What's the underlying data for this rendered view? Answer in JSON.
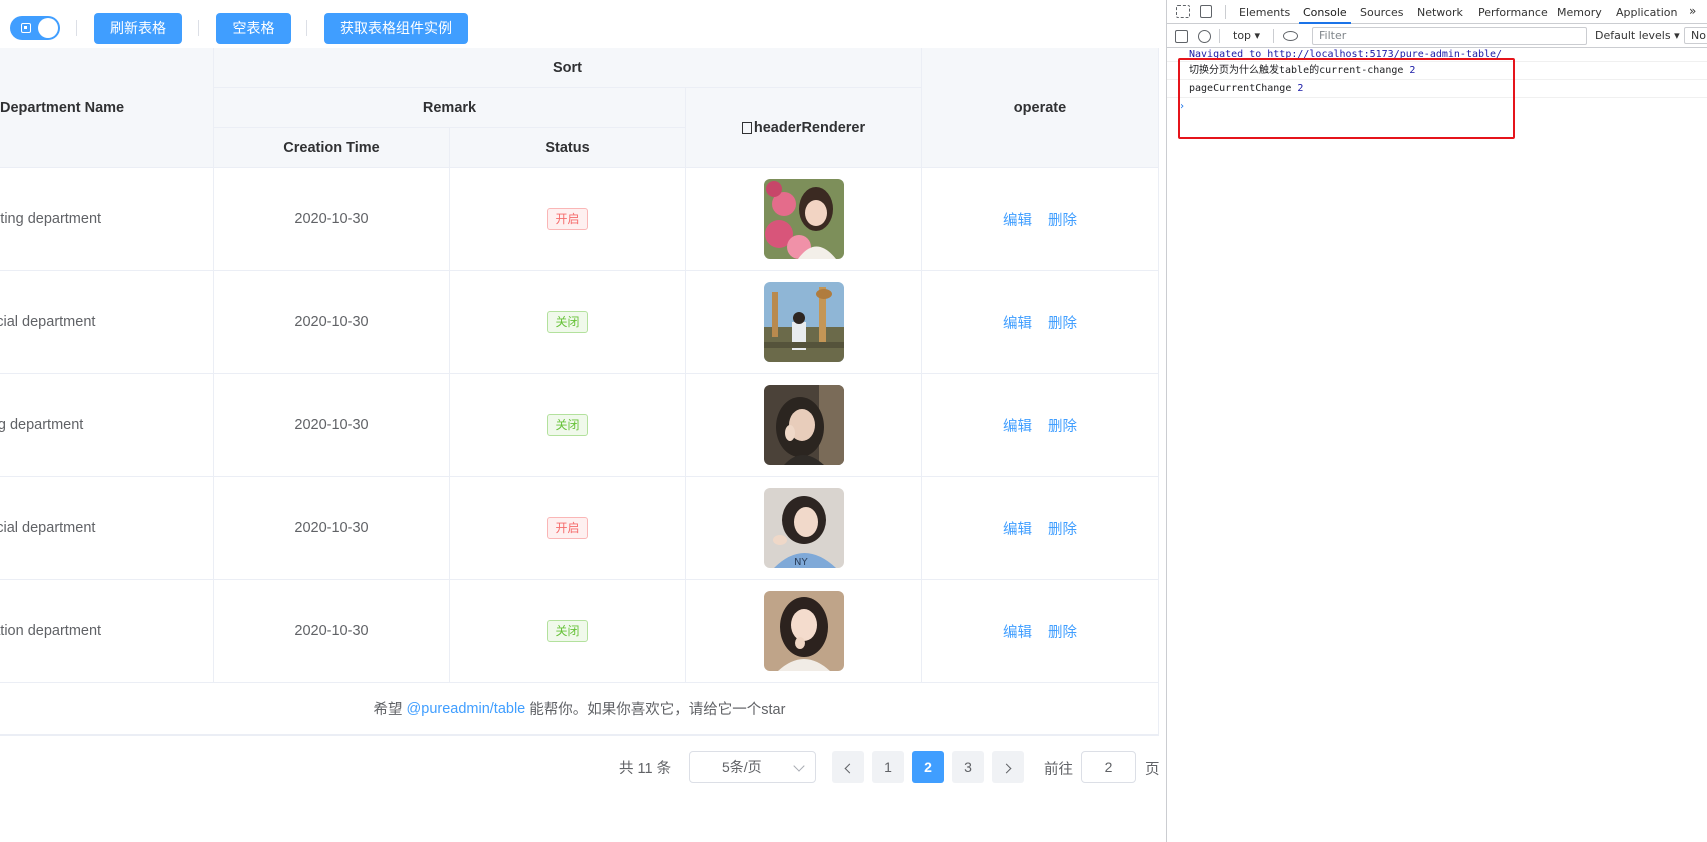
{
  "toolbar": {
    "buttons": [
      "刷新表格",
      "空表格",
      "获取表格组件实例"
    ]
  },
  "table": {
    "headers": {
      "department": "Department Name",
      "sort": "Sort",
      "remark": "Remark",
      "creation": "Creation Time",
      "status": "Status",
      "renderer": "headerRenderer",
      "operate": "operate"
    },
    "rows": [
      {
        "dept": "Marketing department",
        "date": "2020-10-30",
        "status": "开启",
        "on": true,
        "edit": "编辑",
        "del": "删除"
      },
      {
        "dept": "Financial department",
        "date": "2020-10-30",
        "status": "关闭",
        "on": false,
        "edit": "编辑",
        "del": "删除"
      },
      {
        "dept": "Testing department",
        "date": "2020-10-30",
        "status": "关闭",
        "on": false,
        "edit": "编辑",
        "del": "删除"
      },
      {
        "dept": "Financial department",
        "date": "2020-10-30",
        "status": "开启",
        "on": true,
        "edit": "编辑",
        "del": "删除"
      },
      {
        "dept": "Operation department",
        "date": "2020-10-30",
        "status": "关闭",
        "on": false,
        "edit": "编辑",
        "del": "删除"
      }
    ],
    "footer": {
      "prefix": "希望",
      "link": "@pureadmin/table",
      "suffix": "能帮你。如果你喜欢它，请给它一个star"
    }
  },
  "pagination": {
    "total": "共 11 条",
    "page_size": "5条/页",
    "pages": [
      "1",
      "2",
      "3"
    ],
    "current": "2",
    "goto_label": "前往",
    "goto_value": "2",
    "page_suffix": "页"
  },
  "devtools": {
    "tabs": [
      "Elements",
      "Console",
      "Sources",
      "Network",
      "Performance",
      "Memory",
      "Application"
    ],
    "active_tab": "Console",
    "context": "top",
    "filter_placeholder": "Filter",
    "levels": "Default levels",
    "no_issues": "No",
    "nav_message": "Navigated to http://localhost:5173/pure-admin-table/",
    "logs": [
      {
        "text": "切换分页为什么触发table的current-change",
        "value": "2"
      },
      {
        "text": "pageCurrentChange",
        "value": "2"
      }
    ]
  },
  "colors": {
    "accent": "#409eff",
    "danger": "#f56c6c",
    "success": "#67c23a",
    "highlight": "#e5141b"
  }
}
